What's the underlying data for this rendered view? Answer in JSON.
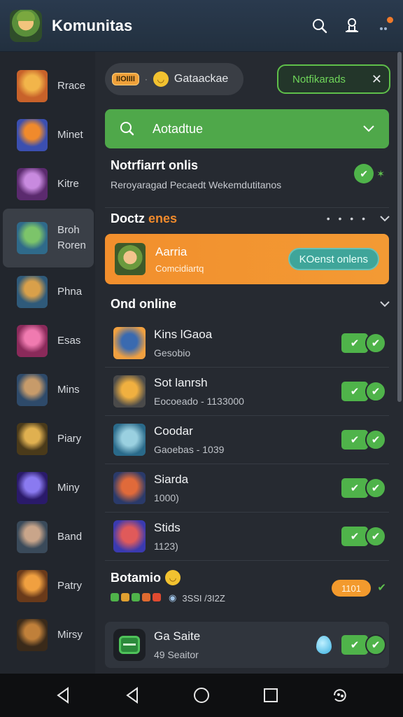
{
  "topbar": {
    "title": "Komunitas"
  },
  "sidebar": {
    "items": [
      {
        "label": "Rrace",
        "colors": [
          "#c8622a",
          "#f2b54a"
        ]
      },
      {
        "label": "Minet",
        "colors": [
          "#3b4fb0",
          "#f08a2c"
        ]
      },
      {
        "label": "Kitre",
        "colors": [
          "#5b2a6e",
          "#c88adf"
        ]
      },
      {
        "label": "Broh\nRoren",
        "colors": [
          "#2f6a8a",
          "#7cc46a"
        ],
        "active": true
      },
      {
        "label": "Phna",
        "colors": [
          "#2f5a7a",
          "#d9a04a"
        ]
      },
      {
        "label": "Esas",
        "colors": [
          "#8a2a5a",
          "#f07ab0"
        ]
      },
      {
        "label": "Mins",
        "colors": [
          "#2e4a6a",
          "#c79b6a"
        ]
      },
      {
        "label": "Piary",
        "colors": [
          "#4a3a1a",
          "#e0b050"
        ]
      },
      {
        "label": "Miny",
        "colors": [
          "#2a1a6a",
          "#8a7af0"
        ]
      },
      {
        "label": "Band",
        "colors": [
          "#3a4a5a",
          "#c9a58a"
        ]
      },
      {
        "label": "Patry",
        "colors": [
          "#6a3a1a",
          "#f0a040"
        ]
      },
      {
        "label": "Mirsy",
        "colors": [
          "#3a2a1a",
          "#c0803a"
        ]
      }
    ]
  },
  "chips": {
    "pill_badge": "IIOIIII",
    "pill_dot": "·",
    "pill_text": "Gataackae",
    "notif_chip": "Notfikarads",
    "notif_close": "✕"
  },
  "green_bar": {
    "text": "Aotadtue"
  },
  "notification": {
    "title": "Notrfiarrt onlis",
    "subtitle": "Reroyaragad Pecaedt Wekemdutitanos"
  },
  "section_1": {
    "title_plain": "Doctz",
    "title_accent": "enes",
    "dots": "• • • •"
  },
  "featured": {
    "title": "Aarria",
    "subtitle": "Comcidiartq",
    "button": "KOenst onlens"
  },
  "section_2": {
    "title": "Ond online"
  },
  "rows": [
    {
      "title": "Kins lGaoa",
      "subtitle": "Gesobio",
      "colors": [
        "#f0a040",
        "#3a6ab0"
      ]
    },
    {
      "title": "Sot lanrsh",
      "subtitle": "Eocoeado - 1133000",
      "colors": [
        "#4a4a4a",
        "#f0b040"
      ]
    },
    {
      "title": "Coodar",
      "subtitle": "Gaoebas - 1039",
      "colors": [
        "#2a6a8a",
        "#9ad0e0"
      ]
    },
    {
      "title": "Siarda",
      "subtitle": "1000)",
      "colors": [
        "#2a3a6a",
        "#e06a3a"
      ]
    },
    {
      "title": "Stids",
      "subtitle": "1123)",
      "colors": [
        "#3a3ab0",
        "#e05a5a"
      ]
    }
  ],
  "misc": {
    "title": "Botamio",
    "subtitle_value": "3SSI /3I2Z",
    "badge": "1101",
    "mini_colors": [
      "#4fb34a",
      "#e0a030",
      "#4fb34a",
      "#e06a30",
      "#e04a30"
    ]
  },
  "bottom_card": {
    "title": "Ga Saite",
    "subtitle": "49 Seaitor"
  }
}
